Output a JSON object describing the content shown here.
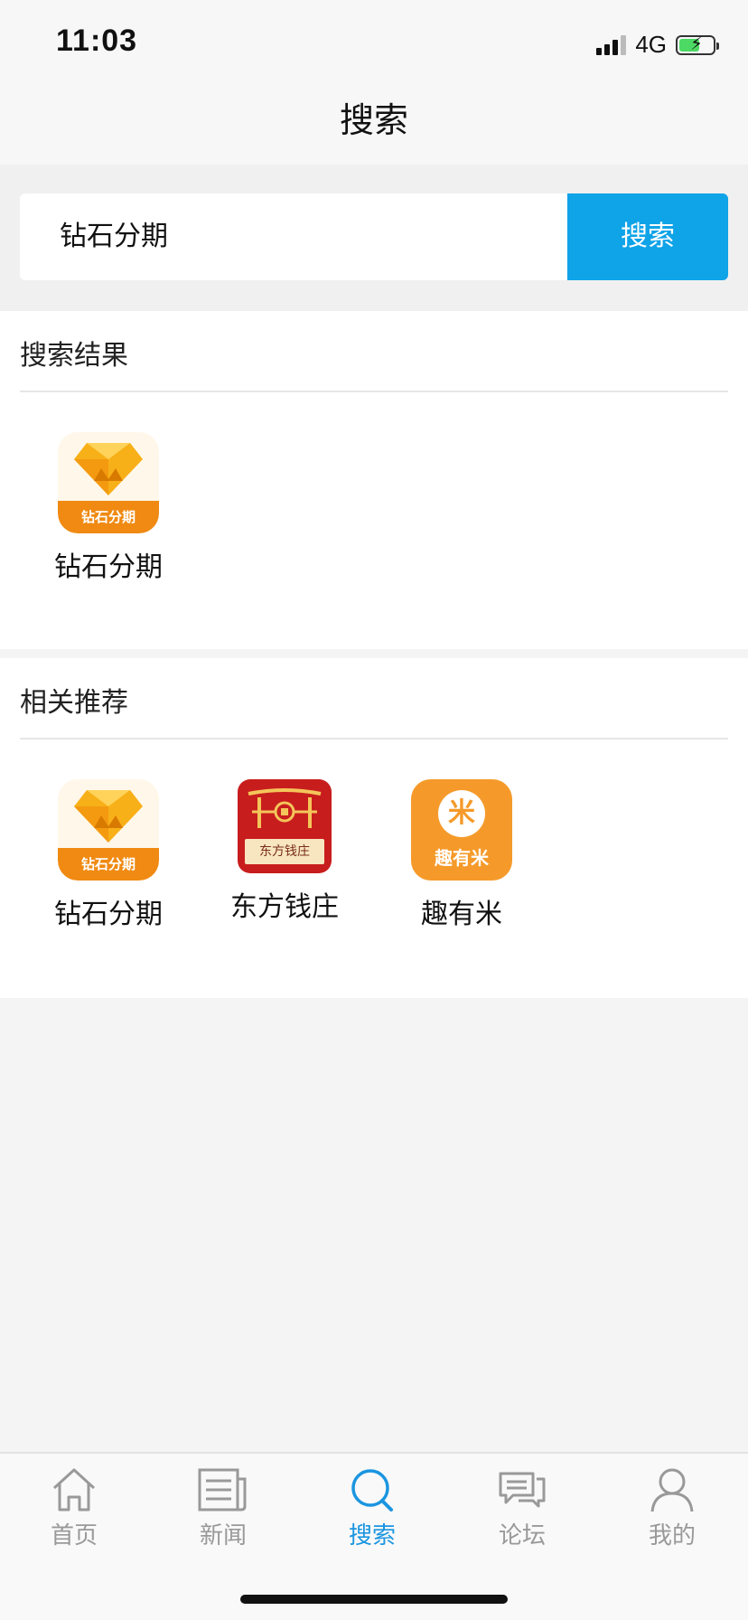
{
  "status_bar": {
    "time": "11:03",
    "network": "4G"
  },
  "header": {
    "title": "搜索"
  },
  "search": {
    "value": "钻石分期",
    "button_label": "搜索"
  },
  "results": {
    "title": "搜索结果",
    "items": [
      {
        "name": "钻石分期",
        "icon": "diamond-installment-icon",
        "icon_band_text": "钻石分期"
      }
    ]
  },
  "recommendations": {
    "title": "相关推荐",
    "items": [
      {
        "name": "钻石分期",
        "icon": "diamond-installment-icon",
        "icon_band_text": "钻石分期"
      },
      {
        "name": "东方钱庄",
        "icon": "dongfang-qianzhuang-icon",
        "icon_band_text": "东方钱庄"
      },
      {
        "name": "趣有米",
        "icon": "quyoumi-icon",
        "icon_band_text": "趣有米",
        "icon_glyph": "米"
      }
    ]
  },
  "tabs": [
    {
      "label": "首页",
      "icon": "home-icon",
      "active": false
    },
    {
      "label": "新闻",
      "icon": "news-icon",
      "active": false
    },
    {
      "label": "搜索",
      "icon": "search-icon",
      "active": true
    },
    {
      "label": "论坛",
      "icon": "forum-icon",
      "active": false
    },
    {
      "label": "我的",
      "icon": "user-icon",
      "active": false
    }
  ],
  "colors": {
    "accent": "#0fa3e8",
    "tab_active": "#1b95e0",
    "tab_inactive": "#999999"
  }
}
